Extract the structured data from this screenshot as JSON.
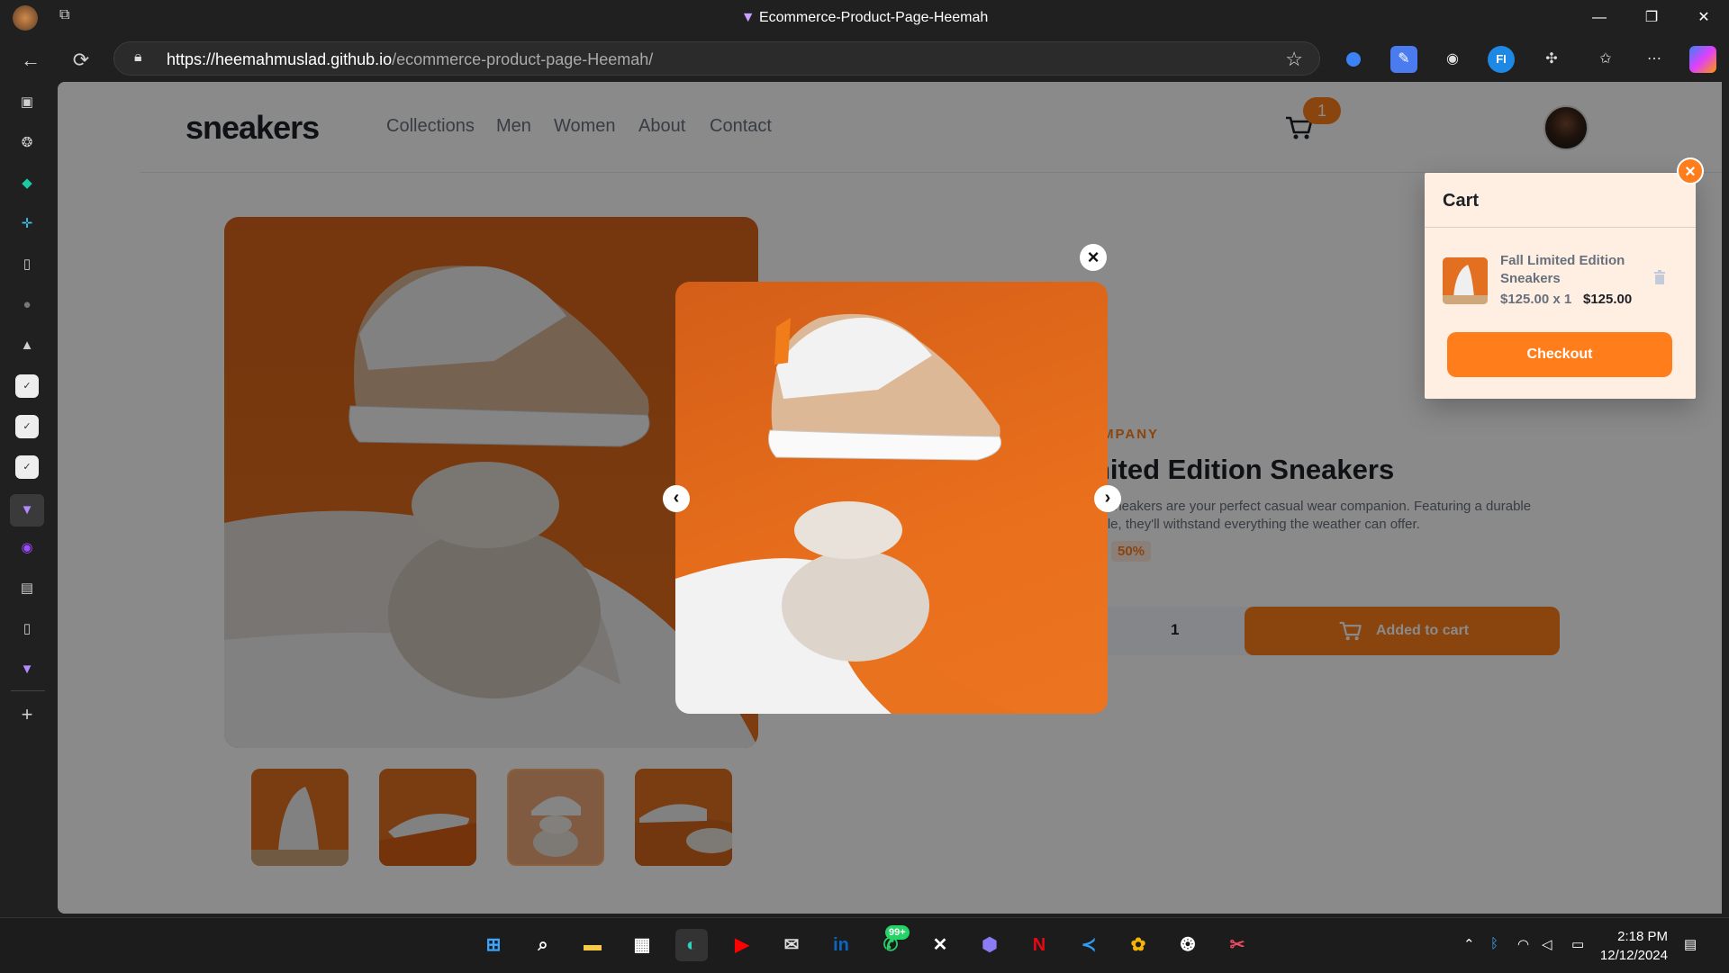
{
  "browser": {
    "window_title": "Ecommerce-Product-Page-Heemah",
    "url_host": "https://heemahmuslad.github.io",
    "url_path": "/ecommerce-product-page-Heemah/",
    "window_controls": {
      "minimize": "—",
      "restore": "❐",
      "close": "✕"
    }
  },
  "store": {
    "logo": "sneakers",
    "nav": [
      "Collections",
      "Men",
      "Women",
      "About",
      "Contact"
    ],
    "cart_count": "1"
  },
  "product": {
    "company": "SNEAKER COMPANY",
    "company_visible": "MPANY",
    "name_visible": "nited Edition Sneakers",
    "desc_line1": "le sneakers are your perfect casual wear companion. Featuring a durable",
    "desc_line2": "sole, they'll withstand everything the weather can offer.",
    "discount": "50%",
    "quantity": "1",
    "plus": "+",
    "add_button": "Added to cart",
    "thumbnail_count": 4
  },
  "lightbox": {
    "close": "×",
    "prev": "‹",
    "next": "›"
  },
  "cart": {
    "title": "Cart",
    "item_name": "Fall Limited Edition Sneakers",
    "item_price_qty": "$125.00 x 1",
    "item_total": "$125.00",
    "checkout": "Checkout",
    "close": "×"
  },
  "taskbar": {
    "time": "2:18 PM",
    "date": "12/12/2024",
    "whatsapp_badge": "99+"
  },
  "colors": {
    "accent": "#ff7e1b",
    "pale_orange": "#ffefe2",
    "dark_text": "#1d2026",
    "gray_text": "#68707d"
  }
}
